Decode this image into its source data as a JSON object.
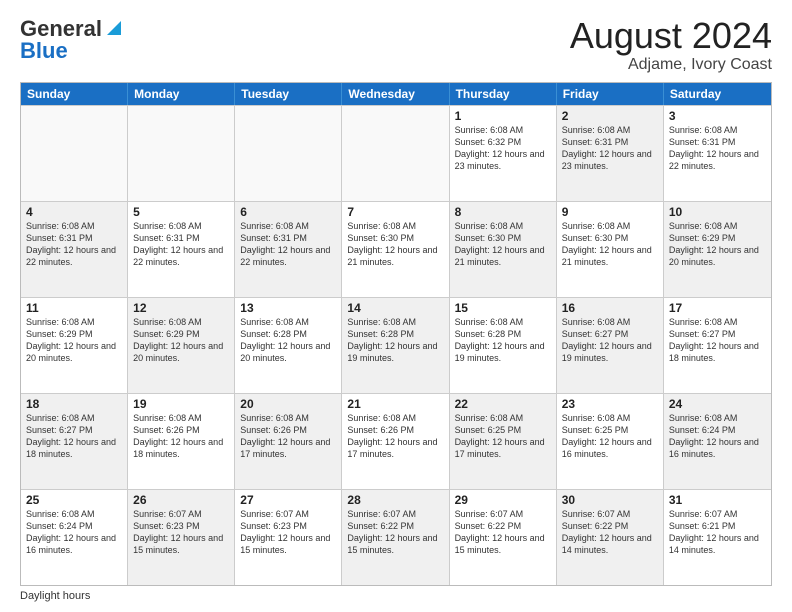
{
  "logo": {
    "line1": "General",
    "line2": "Blue"
  },
  "title": "August 2024",
  "subtitle": "Adjame, Ivory Coast",
  "days_header": [
    "Sunday",
    "Monday",
    "Tuesday",
    "Wednesday",
    "Thursday",
    "Friday",
    "Saturday"
  ],
  "weeks": [
    {
      "cells": [
        {
          "day": "",
          "info": "",
          "empty": true
        },
        {
          "day": "",
          "info": "",
          "empty": true
        },
        {
          "day": "",
          "info": "",
          "empty": true
        },
        {
          "day": "",
          "info": "",
          "empty": true
        },
        {
          "day": "1",
          "info": "Sunrise: 6:08 AM\nSunset: 6:32 PM\nDaylight: 12 hours and 23 minutes."
        },
        {
          "day": "2",
          "info": "Sunrise: 6:08 AM\nSunset: 6:31 PM\nDaylight: 12 hours and 23 minutes.",
          "shaded": true
        },
        {
          "day": "3",
          "info": "Sunrise: 6:08 AM\nSunset: 6:31 PM\nDaylight: 12 hours and 22 minutes."
        }
      ]
    },
    {
      "cells": [
        {
          "day": "4",
          "info": "Sunrise: 6:08 AM\nSunset: 6:31 PM\nDaylight: 12 hours and 22 minutes.",
          "shaded": true
        },
        {
          "day": "5",
          "info": "Sunrise: 6:08 AM\nSunset: 6:31 PM\nDaylight: 12 hours and 22 minutes."
        },
        {
          "day": "6",
          "info": "Sunrise: 6:08 AM\nSunset: 6:31 PM\nDaylight: 12 hours and 22 minutes.",
          "shaded": true
        },
        {
          "day": "7",
          "info": "Sunrise: 6:08 AM\nSunset: 6:30 PM\nDaylight: 12 hours and 21 minutes."
        },
        {
          "day": "8",
          "info": "Sunrise: 6:08 AM\nSunset: 6:30 PM\nDaylight: 12 hours and 21 minutes.",
          "shaded": true
        },
        {
          "day": "9",
          "info": "Sunrise: 6:08 AM\nSunset: 6:30 PM\nDaylight: 12 hours and 21 minutes."
        },
        {
          "day": "10",
          "info": "Sunrise: 6:08 AM\nSunset: 6:29 PM\nDaylight: 12 hours and 20 minutes.",
          "shaded": true
        }
      ]
    },
    {
      "cells": [
        {
          "day": "11",
          "info": "Sunrise: 6:08 AM\nSunset: 6:29 PM\nDaylight: 12 hours and 20 minutes."
        },
        {
          "day": "12",
          "info": "Sunrise: 6:08 AM\nSunset: 6:29 PM\nDaylight: 12 hours and 20 minutes.",
          "shaded": true
        },
        {
          "day": "13",
          "info": "Sunrise: 6:08 AM\nSunset: 6:28 PM\nDaylight: 12 hours and 20 minutes."
        },
        {
          "day": "14",
          "info": "Sunrise: 6:08 AM\nSunset: 6:28 PM\nDaylight: 12 hours and 19 minutes.",
          "shaded": true
        },
        {
          "day": "15",
          "info": "Sunrise: 6:08 AM\nSunset: 6:28 PM\nDaylight: 12 hours and 19 minutes."
        },
        {
          "day": "16",
          "info": "Sunrise: 6:08 AM\nSunset: 6:27 PM\nDaylight: 12 hours and 19 minutes.",
          "shaded": true
        },
        {
          "day": "17",
          "info": "Sunrise: 6:08 AM\nSunset: 6:27 PM\nDaylight: 12 hours and 18 minutes."
        }
      ]
    },
    {
      "cells": [
        {
          "day": "18",
          "info": "Sunrise: 6:08 AM\nSunset: 6:27 PM\nDaylight: 12 hours and 18 minutes.",
          "shaded": true
        },
        {
          "day": "19",
          "info": "Sunrise: 6:08 AM\nSunset: 6:26 PM\nDaylight: 12 hours and 18 minutes."
        },
        {
          "day": "20",
          "info": "Sunrise: 6:08 AM\nSunset: 6:26 PM\nDaylight: 12 hours and 17 minutes.",
          "shaded": true
        },
        {
          "day": "21",
          "info": "Sunrise: 6:08 AM\nSunset: 6:26 PM\nDaylight: 12 hours and 17 minutes."
        },
        {
          "day": "22",
          "info": "Sunrise: 6:08 AM\nSunset: 6:25 PM\nDaylight: 12 hours and 17 minutes.",
          "shaded": true
        },
        {
          "day": "23",
          "info": "Sunrise: 6:08 AM\nSunset: 6:25 PM\nDaylight: 12 hours and 16 minutes."
        },
        {
          "day": "24",
          "info": "Sunrise: 6:08 AM\nSunset: 6:24 PM\nDaylight: 12 hours and 16 minutes.",
          "shaded": true
        }
      ]
    },
    {
      "cells": [
        {
          "day": "25",
          "info": "Sunrise: 6:08 AM\nSunset: 6:24 PM\nDaylight: 12 hours and 16 minutes."
        },
        {
          "day": "26",
          "info": "Sunrise: 6:07 AM\nSunset: 6:23 PM\nDaylight: 12 hours and 15 minutes.",
          "shaded": true
        },
        {
          "day": "27",
          "info": "Sunrise: 6:07 AM\nSunset: 6:23 PM\nDaylight: 12 hours and 15 minutes."
        },
        {
          "day": "28",
          "info": "Sunrise: 6:07 AM\nSunset: 6:22 PM\nDaylight: 12 hours and 15 minutes.",
          "shaded": true
        },
        {
          "day": "29",
          "info": "Sunrise: 6:07 AM\nSunset: 6:22 PM\nDaylight: 12 hours and 15 minutes."
        },
        {
          "day": "30",
          "info": "Sunrise: 6:07 AM\nSunset: 6:22 PM\nDaylight: 12 hours and 14 minutes.",
          "shaded": true
        },
        {
          "day": "31",
          "info": "Sunrise: 6:07 AM\nSunset: 6:21 PM\nDaylight: 12 hours and 14 minutes."
        }
      ]
    }
  ],
  "footer": "Daylight hours"
}
